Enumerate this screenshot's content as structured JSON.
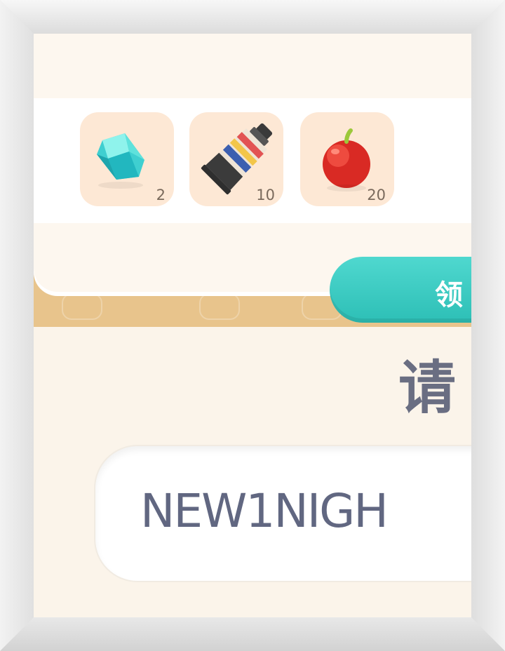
{
  "rewards": [
    {
      "icon": "gem-icon",
      "count": "2"
    },
    {
      "icon": "paint-tube-icon",
      "count": "10"
    },
    {
      "icon": "apple-icon",
      "count": "20"
    }
  ],
  "claim_button": {
    "label": "领"
  },
  "prompt": {
    "title": "请"
  },
  "code_input": {
    "value": "NEW1NIGH"
  },
  "colors": {
    "accent": "#33c7bf",
    "reward_tile": "#fde8d5",
    "band": "#e8c48c",
    "text": "#616781"
  }
}
